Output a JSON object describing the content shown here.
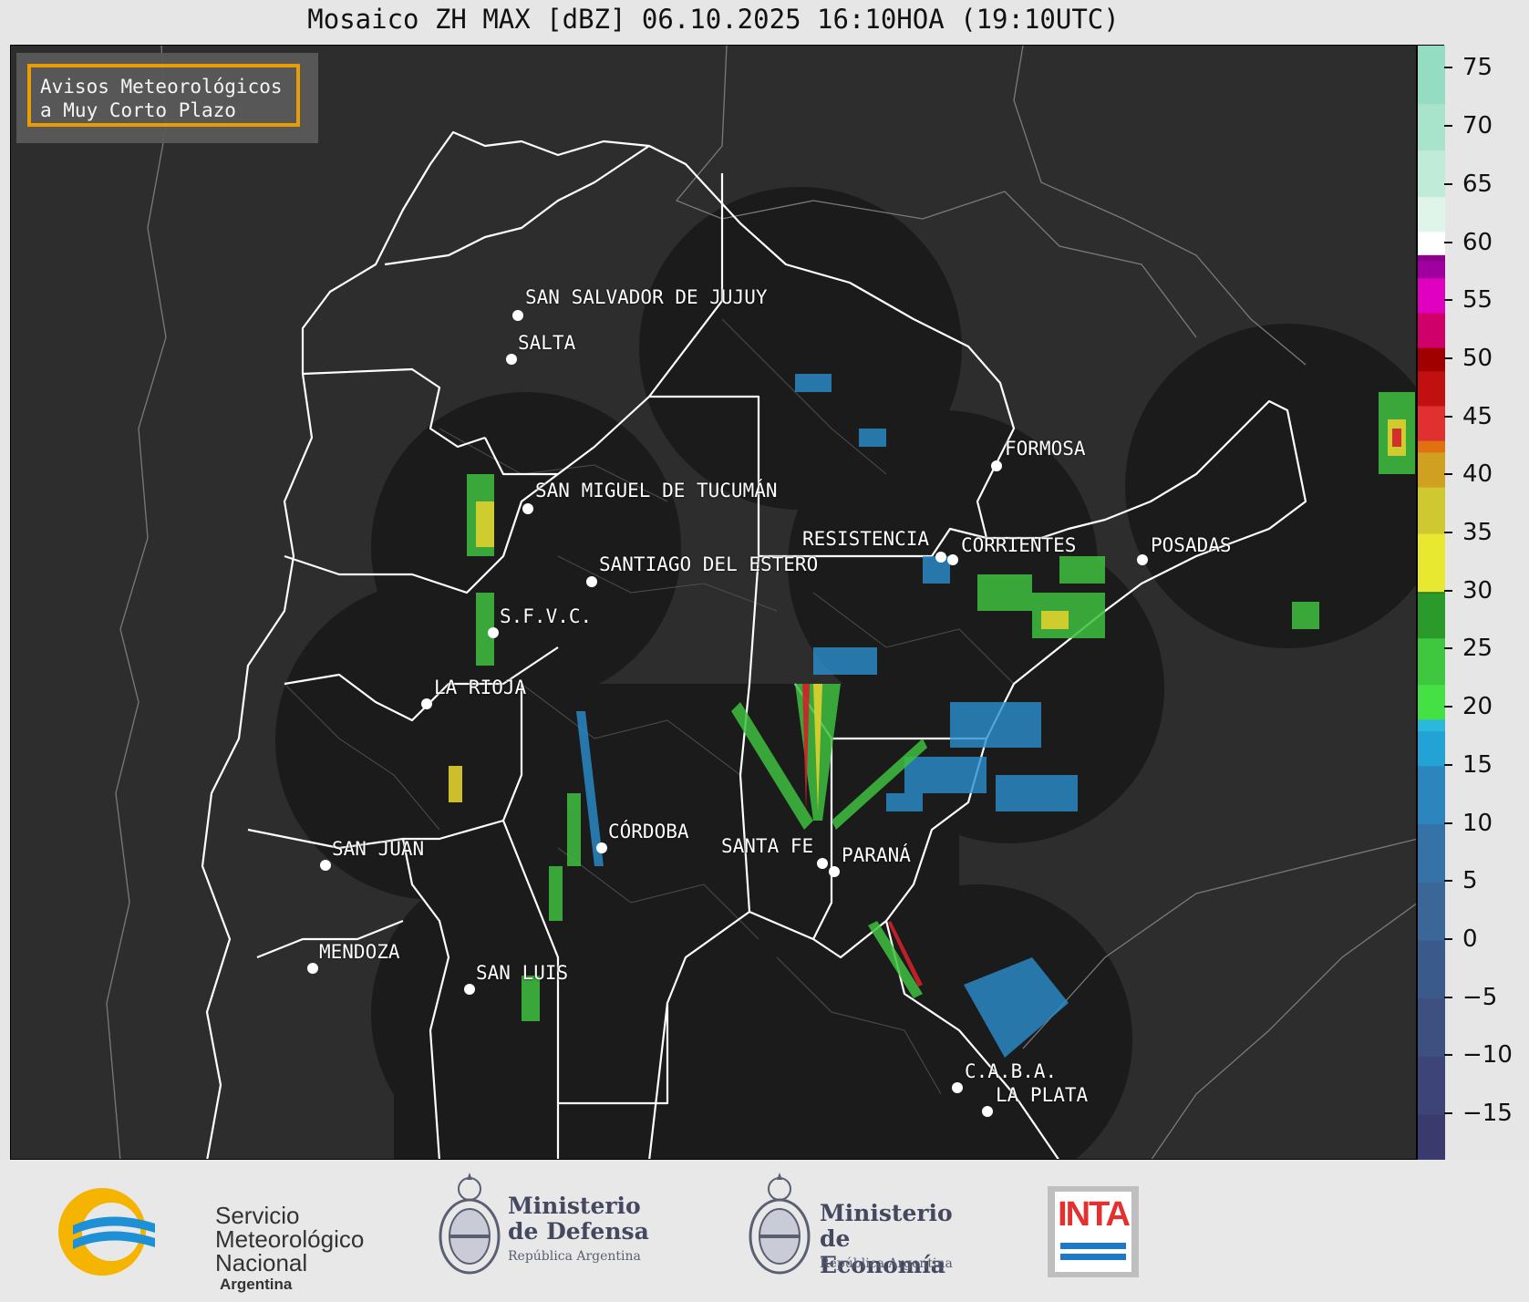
{
  "title": "Mosaico ZH MAX [dBZ] 06.10.2025 16:10HOA (19:10UTC)",
  "notice": {
    "line1": "Avisos Meteorológicos",
    "line2": "a Muy Corto Plazo"
  },
  "cities": [
    {
      "name": "SAN SALVADOR DE JUJUY"
    },
    {
      "name": "SALTA"
    },
    {
      "name": "FORMOSA"
    },
    {
      "name": "SAN MIGUEL DE TUCUMÁN"
    },
    {
      "name": "RESISTENCIA"
    },
    {
      "name": "CORRIENTES"
    },
    {
      "name": "POSADAS"
    },
    {
      "name": "SANTIAGO DEL ESTERO"
    },
    {
      "name": "S.F.V.C."
    },
    {
      "name": "LA RIOJA"
    },
    {
      "name": "CÓRDOBA"
    },
    {
      "name": "SANTA FE"
    },
    {
      "name": "PARANÁ"
    },
    {
      "name": "SAN JUAN"
    },
    {
      "name": "MENDOZA"
    },
    {
      "name": "SAN LUIS"
    },
    {
      "name": "C.A.B.A."
    },
    {
      "name": "LA PLATA"
    }
  ],
  "colorbar": {
    "unit": "dBZ",
    "min": -19,
    "max": 77,
    "ticks": [
      "75",
      "70",
      "65",
      "60",
      "55",
      "50",
      "45",
      "40",
      "35",
      "30",
      "25",
      "20",
      "15",
      "10",
      "5",
      "0",
      "−5",
      "−10",
      "−15"
    ],
    "tick_values": [
      75,
      70,
      65,
      60,
      55,
      50,
      45,
      40,
      35,
      30,
      25,
      20,
      15,
      10,
      5,
      0,
      -5,
      -10,
      -15
    ]
  },
  "colors": {
    "map_background": "#2d2d2d",
    "radar_coverage": "#1b1b1b",
    "notice_border": "#f5a300"
  },
  "footer": {
    "smn": {
      "l1": "Servicio",
      "l2": "Meteorológico",
      "l3": "Nacional",
      "l4": "Argentina"
    },
    "defensa": {
      "l1": "Ministerio",
      "l2": "de Defensa",
      "l3": "República Argentina"
    },
    "economia": {
      "l1": "Ministerio",
      "l2": "de Economía",
      "l3": "República Argentina"
    },
    "inta": {
      "text": "INTA"
    }
  }
}
